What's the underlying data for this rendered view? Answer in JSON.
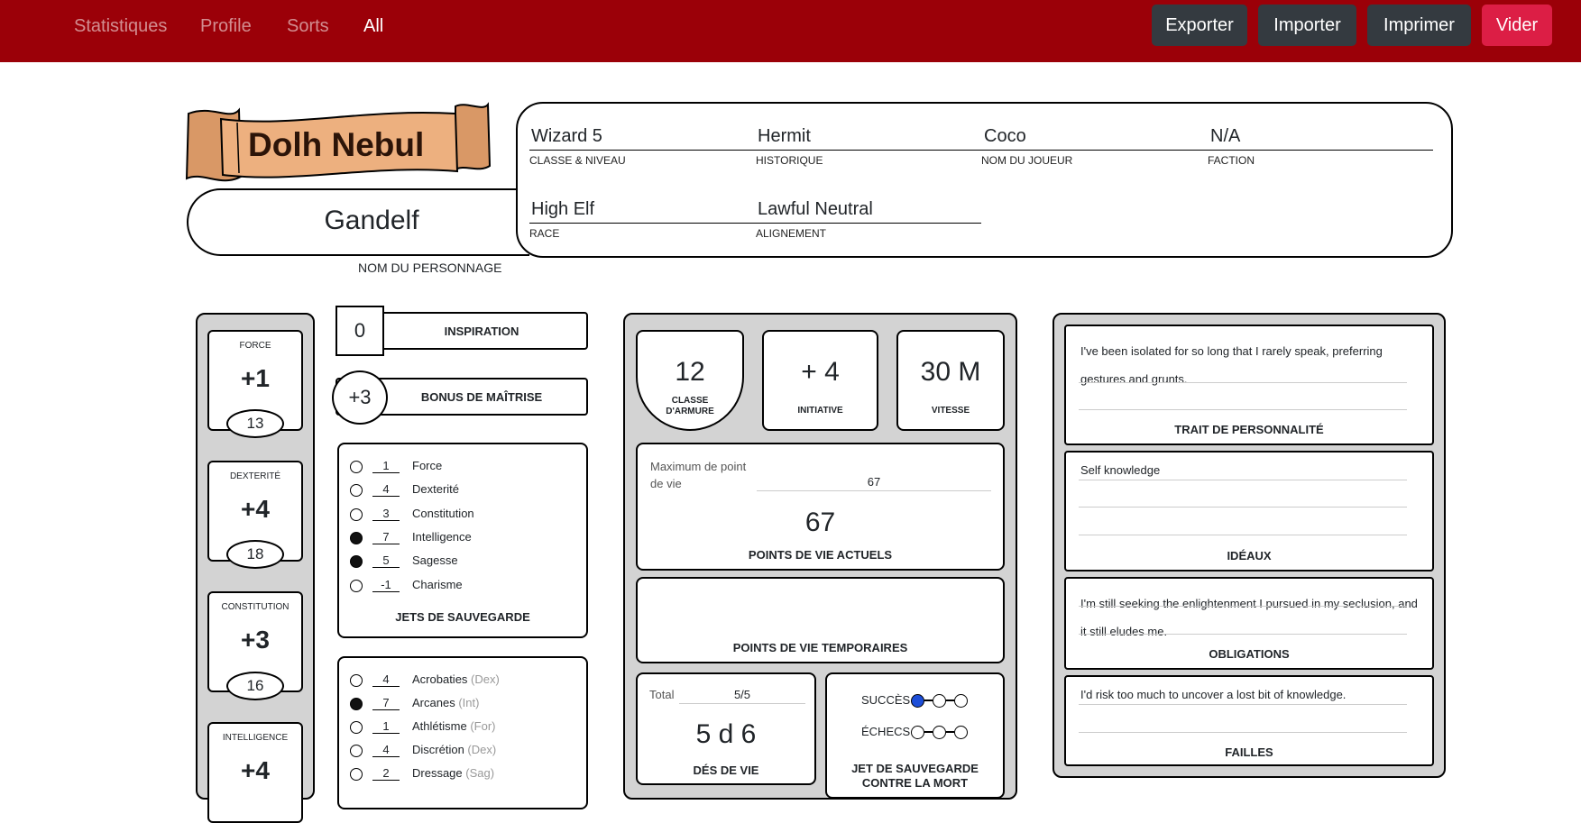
{
  "nav": {
    "links": [
      "Statistiques",
      "Profile",
      "Sorts",
      "All"
    ],
    "active": "All",
    "buttons": [
      "Exporter",
      "Importer",
      "Imprimer",
      "Vider"
    ]
  },
  "colors": {
    "navbar": "#9b0008",
    "button_dark": "#343a40",
    "button_danger": "#dc1e45",
    "banner": "#e8a87c"
  },
  "header": {
    "banner_name": "Dolh Nebul",
    "character_name": "Gandelf",
    "character_name_caption": "NOM DU PERSONNAGE",
    "class_level": "Wizard 5",
    "class_level_caption": "CLASSE & NIVEAU",
    "background": "Hermit",
    "background_caption": "HISTORIQUE",
    "player_name": "Coco",
    "player_name_caption": "NOM DU JOUEUR",
    "faction": "N/A",
    "faction_caption": "FACTION",
    "race": "High Elf",
    "race_caption": "RACE",
    "alignment": "Lawful Neutral",
    "alignment_caption": "ALIGNEMENT"
  },
  "abilities": [
    {
      "label": "FORCE",
      "mod": "+1",
      "score": "13"
    },
    {
      "label": "DEXTERITÉ",
      "mod": "+4",
      "score": "18"
    },
    {
      "label": "CONSTITUTION",
      "mod": "+3",
      "score": "16"
    },
    {
      "label": "INTELLIGENCE",
      "mod": "+4",
      "score": ""
    }
  ],
  "inspiration": {
    "value": "0",
    "label": "INSPIRATION"
  },
  "proficiency": {
    "value": "+3",
    "label": "BONUS DE MAÎTRISE"
  },
  "saving_throws": {
    "title": "JETS DE SAUVEGARDE",
    "rows": [
      {
        "value": "1",
        "name": "Force",
        "proficient": false
      },
      {
        "value": "4",
        "name": "Dexterité",
        "proficient": false
      },
      {
        "value": "3",
        "name": "Constitution",
        "proficient": false
      },
      {
        "value": "7",
        "name": "Intelligence",
        "proficient": true
      },
      {
        "value": "5",
        "name": "Sagesse",
        "proficient": true
      },
      {
        "value": "-1",
        "name": "Charisme",
        "proficient": false
      }
    ]
  },
  "skills": [
    {
      "value": "4",
      "name": "Acrobaties",
      "ability": "(Dex)",
      "proficient": false
    },
    {
      "value": "7",
      "name": "Arcanes",
      "ability": "(Int)",
      "proficient": true
    },
    {
      "value": "1",
      "name": "Athlétisme",
      "ability": "(For)",
      "proficient": false
    },
    {
      "value": "4",
      "name": "Discrétion",
      "ability": "(Dex)",
      "proficient": false
    },
    {
      "value": "2",
      "name": "Dressage",
      "ability": "(Sag)",
      "proficient": false
    }
  ],
  "combat": {
    "ac": {
      "value": "12",
      "label": "CLASSE D'ARMURE"
    },
    "initiative": {
      "value": "+ 4",
      "label": "INITIATIVE"
    },
    "speed": {
      "value": "30 M",
      "label": "VITESSE"
    },
    "hp_max_label": "Maximum de point de vie",
    "hp_max": "67",
    "hp_current": "67",
    "hp_current_label": "POINTS DE VIE ACTUELS",
    "hp_temp_label": "POINTS DE VIE TEMPORAIRES",
    "hit_dice_total_label": "Total",
    "hit_dice_total": "5/5",
    "hit_dice": "5 d 6",
    "hit_dice_label": "DÉS DE VIE",
    "death_saves_success_label": "SUCCÈS",
    "death_saves_fail_label": "ÉCHECS",
    "death_saves_label": "JET DE SAUVEGARDE CONTRE LA MORT",
    "successes": 1,
    "failures": 0
  },
  "traits": {
    "personality": "I've been isolated for so long that I rarely speak, preferring gestures and grunts.",
    "personality_label": "TRAIT DE PERSONNALITÉ",
    "ideals": "Self knowledge",
    "ideals_label": "IDÉAUX",
    "bonds": "I'm still seeking the enlightenment I pursued in my seclusion, and it still eludes me.",
    "bonds_label": "OBLIGATIONS",
    "flaws": "I'd risk too much to uncover a lost bit of knowledge.",
    "flaws_label": "FAILLES"
  }
}
